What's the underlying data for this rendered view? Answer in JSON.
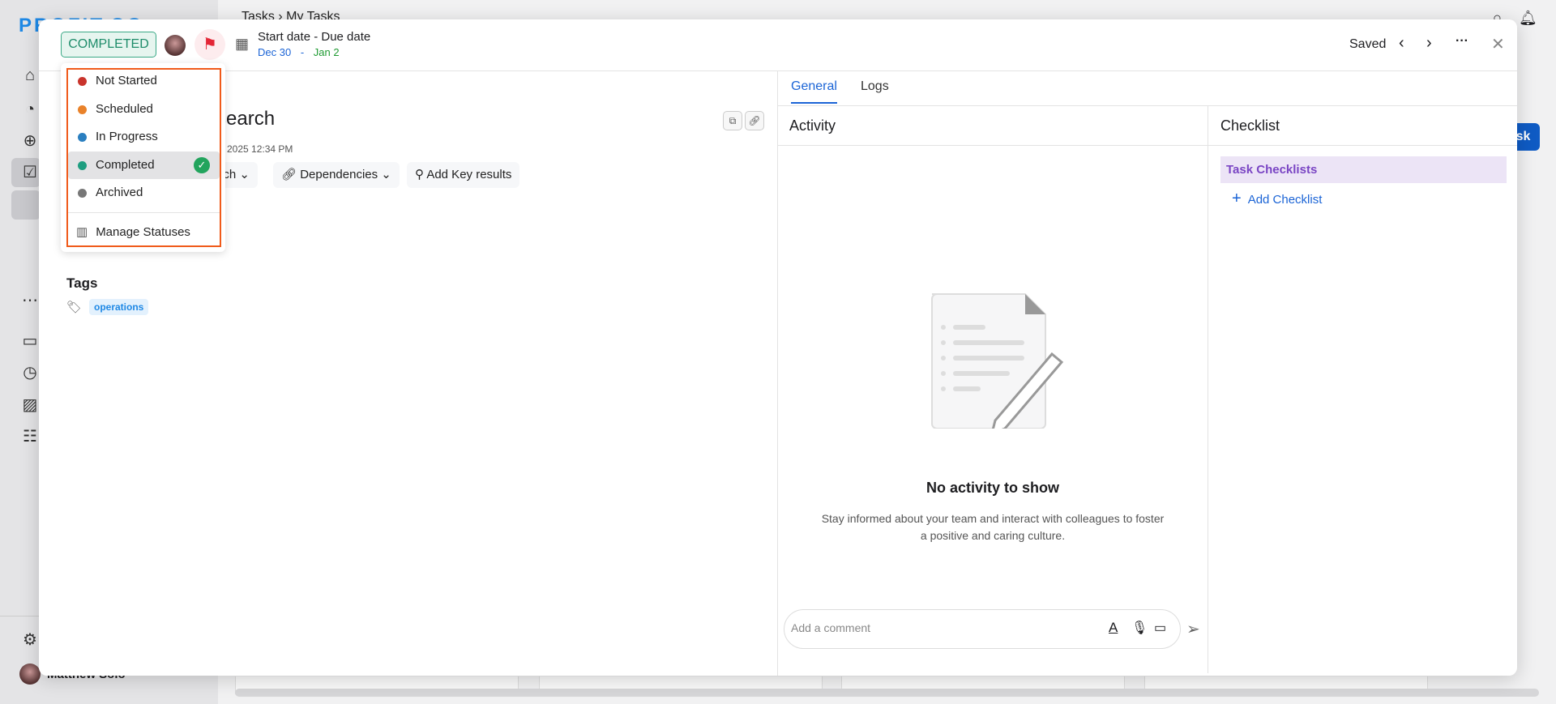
{
  "background": {
    "logo": "PROFIT.CO",
    "breadcrumb": [
      "Tasks",
      "My Tasks"
    ],
    "user_name": "Matthew Solo",
    "new_task_partial": "sk"
  },
  "header": {
    "status": "COMPLETED",
    "date_label": "Start date - Due date",
    "start_date": "Dec 30",
    "date_sep": "-",
    "due_date": "Jan 2",
    "saved": "Saved"
  },
  "status_menu": {
    "items": [
      {
        "label": "Not Started",
        "color": "#c9342c"
      },
      {
        "label": "Scheduled",
        "color": "#e9822a"
      },
      {
        "label": "In Progress",
        "color": "#2a7fc0"
      },
      {
        "label": "Completed",
        "color": "#1e9e80",
        "selected": true
      },
      {
        "label": "Archived",
        "color": "#777777"
      }
    ],
    "manage": "Manage Statuses"
  },
  "task": {
    "title_partial": "search",
    "date_partial": "2025 12:34 PM",
    "buttons": {
      "attach_partial": "ach",
      "dependencies": "Dependencies",
      "key_results": "Add Key results"
    },
    "tags_label": "Tags",
    "tags": [
      "operations"
    ]
  },
  "tabs": [
    "General",
    "Logs"
  ],
  "activity": {
    "title": "Activity",
    "empty_title": "No activity to show",
    "empty_desc": "Stay informed about your team and interact with colleagues to foster a positive and caring culture.",
    "comment_placeholder": "Add a comment"
  },
  "checklist": {
    "title": "Checklist",
    "group": "Task Checklists",
    "add": "Add Checklist"
  }
}
